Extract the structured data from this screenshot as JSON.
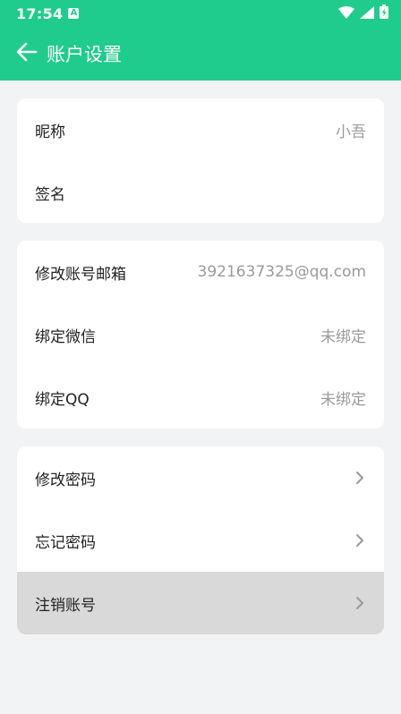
{
  "status_bar": {
    "time": "17:54",
    "notification_icon": "a-letter-icon",
    "icons": [
      "wifi-icon",
      "signal-icon",
      "battery-icon"
    ]
  },
  "toolbar": {
    "back_icon": "arrow-left-icon",
    "title": "账户设置"
  },
  "colors": {
    "accent": "#1fcc8d",
    "background": "#f2f3f5",
    "value_text": "#9a9a9a",
    "pressed_row": "#d9d9d9"
  },
  "sections": [
    {
      "rows": [
        {
          "label": "昵称",
          "value": "小吾"
        },
        {
          "label": "签名",
          "value": ""
        }
      ]
    },
    {
      "rows": [
        {
          "label": "修改账号邮箱",
          "value": "3921637325@qq.com"
        },
        {
          "label": "绑定微信",
          "value": "未绑定"
        },
        {
          "label": "绑定QQ",
          "value": "未绑定"
        }
      ]
    },
    {
      "rows": [
        {
          "label": "修改密码",
          "icon": "chevron-right-icon"
        },
        {
          "label": "忘记密码",
          "icon": "chevron-right-icon"
        },
        {
          "label": "注销账号",
          "icon": "chevron-right-icon",
          "pressed": true
        }
      ]
    }
  ]
}
